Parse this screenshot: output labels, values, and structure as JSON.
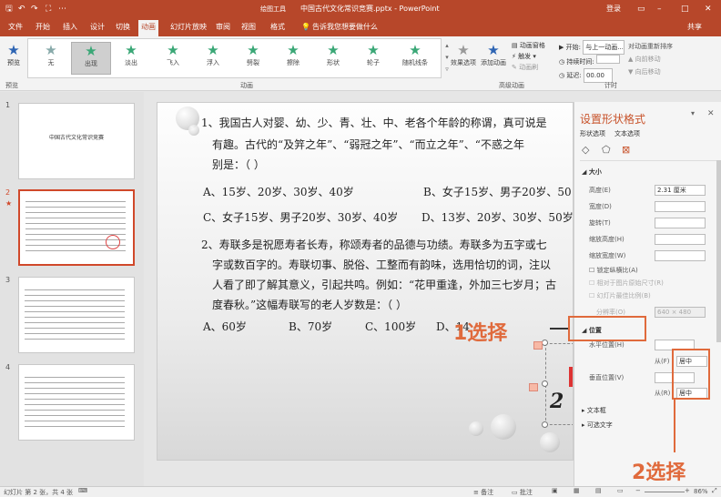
{
  "titlebar": {
    "title": "中国古代文化常识竞赛.pptx - PowerPoint",
    "tool_tab": "绘图工具",
    "login": "登录",
    "share": "共享"
  },
  "tabs": [
    "文件",
    "开始",
    "插入",
    "设计",
    "切换",
    "动画",
    "幻灯片放映",
    "审阅",
    "视图",
    "格式"
  ],
  "active_tab": "动画",
  "tellme": "告诉我您想要做什么",
  "ribbon": {
    "preview": "预览",
    "effects": [
      "无",
      "出现",
      "淡出",
      "飞入",
      "浮入",
      "劈裂",
      "擦除",
      "形状",
      "轮子",
      "随机线条"
    ],
    "selected_effect": "出现",
    "effect_options": "效果选项",
    "add_animation": "添加动画",
    "anim_pane": "动画窗格",
    "trigger": "触发",
    "anim_painter": "动画刷",
    "start_label": "开始:",
    "start_value": "与上一动画...",
    "duration_label": "持续时间:",
    "delay_label": "延迟:",
    "delay_value": "00.00",
    "reorder": "对动画重新排序",
    "move_earlier": "向前移动",
    "move_later": "向后移动",
    "group_preview": "预览",
    "group_anim": "动画",
    "group_adv": "高级动画",
    "group_timing": "计时"
  },
  "thumbs": [
    {
      "num": "1",
      "title": "中国古代文化常识竞赛"
    },
    {
      "num": "2",
      "star": "★"
    },
    {
      "num": "3"
    },
    {
      "num": "4"
    }
  ],
  "slide": {
    "lines": [
      "1、我国古人对婴、幼、少、青、壮、中、老各个年龄的称谓，真可说是",
      "有趣。古代的“及笄之年”、“弱冠之年”、“而立之年”、“不惑之年",
      "别是：（ ）",
      "A、15岁、20岁、30岁、40岁",
      "B、女子15岁、男子20岁、50",
      "C、女子15岁、男子20岁、30岁、40岁",
      "D、13岁、20岁、30岁、50岁",
      "2、寿联多是祝愿寿者长寿，称颂寿者的品德与功绩。寿联多为五字或七",
      "字或数百字的。寿联切事、脱俗、工整而有韵味，选用恰切的词，注以",
      "人看了即了解其意义，引起共鸣。例如：“花甲重逢，外加三七岁月；古",
      "度春秋。”这幅寿联写的老人岁数是：（ ）",
      "A、60岁",
      "B、70岁",
      "C、100岁",
      "D、14"
    ],
    "figure_label": "2"
  },
  "pane": {
    "title": "设置形状格式",
    "tab1": "形状选项",
    "tab2": "文本选项",
    "size_header": "大小",
    "height_label": "高度(E)",
    "height_value": "2.31 厘米",
    "width_label": "宽度(D)",
    "rotation_label": "旋转(T)",
    "scale_h_label": "缩放高度(H)",
    "scale_w_label": "缩放宽度(W)",
    "lock_ratio": "锁定纵横比(A)",
    "relative_orig": "相对于图片原始尺寸(R)",
    "best_scale": "幻灯片最佳比例(B)",
    "resolution_label": "分辨率(O)",
    "resolution_value": "640 × 480",
    "position_header": "位置",
    "horiz_label": "水平位置(H)",
    "from_label": "从(F)",
    "from_value": "居中",
    "vert_label": "垂直位置(V)",
    "from2_label": "从(R)",
    "from2_value": "居中",
    "textbox": "文本框",
    "alt_text": "可选文字"
  },
  "annotations": {
    "step1": "1选择",
    "step2": "2选择"
  },
  "status": {
    "slide_info": "幻灯片 第 2 张，共 4 张",
    "notes": "备注",
    "comments": "批注",
    "zoom": "86%"
  },
  "colors": {
    "brand": "#b7472a",
    "annotation": "#e06a3c"
  }
}
